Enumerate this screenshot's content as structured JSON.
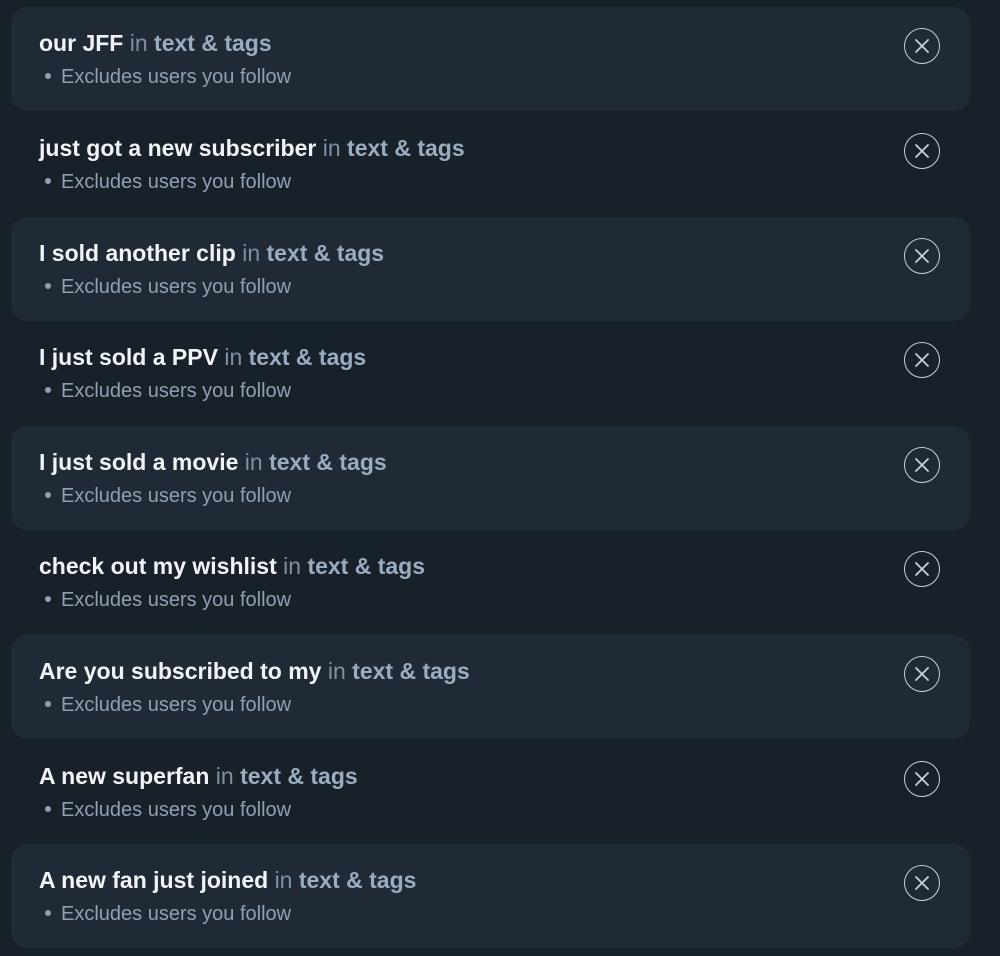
{
  "filters": [
    {
      "phrase": "our JFF",
      "in_word": "in",
      "scope": "text & tags",
      "note": "Excludes users you follow",
      "remove_icon": "close-icon"
    },
    {
      "phrase": "just got a new subscriber",
      "in_word": "in",
      "scope": "text & tags",
      "note": "Excludes users you follow",
      "remove_icon": "close-icon"
    },
    {
      "phrase": "I sold another clip",
      "in_word": "in",
      "scope": "text & tags",
      "note": "Excludes users you follow",
      "remove_icon": "close-icon"
    },
    {
      "phrase": "I just sold a PPV",
      "in_word": "in",
      "scope": "text & tags",
      "note": "Excludes users you follow",
      "remove_icon": "close-icon"
    },
    {
      "phrase": "I just sold a movie",
      "in_word": "in",
      "scope": "text & tags",
      "note": "Excludes users you follow",
      "remove_icon": "close-icon"
    },
    {
      "phrase": "check out my wishlist",
      "in_word": "in",
      "scope": "text & tags",
      "note": "Excludes users you follow",
      "remove_icon": "close-icon"
    },
    {
      "phrase": "Are you subscribed to my",
      "in_word": "in",
      "scope": "text & tags",
      "note": "Excludes users you follow",
      "remove_icon": "close-icon"
    },
    {
      "phrase": "A new superfan",
      "in_word": "in",
      "scope": "text & tags",
      "note": "Excludes users you follow",
      "remove_icon": "close-icon"
    },
    {
      "phrase": "A new fan just joined",
      "in_word": "in",
      "scope": "text & tags",
      "note": "Excludes users you follow",
      "remove_icon": "close-icon"
    }
  ],
  "colors": {
    "background": "#18202a",
    "row_alt": "#1f2a36",
    "phrase": "#f1f4f7",
    "scope": "#9aacbf",
    "muted": "#8fa0b2"
  }
}
